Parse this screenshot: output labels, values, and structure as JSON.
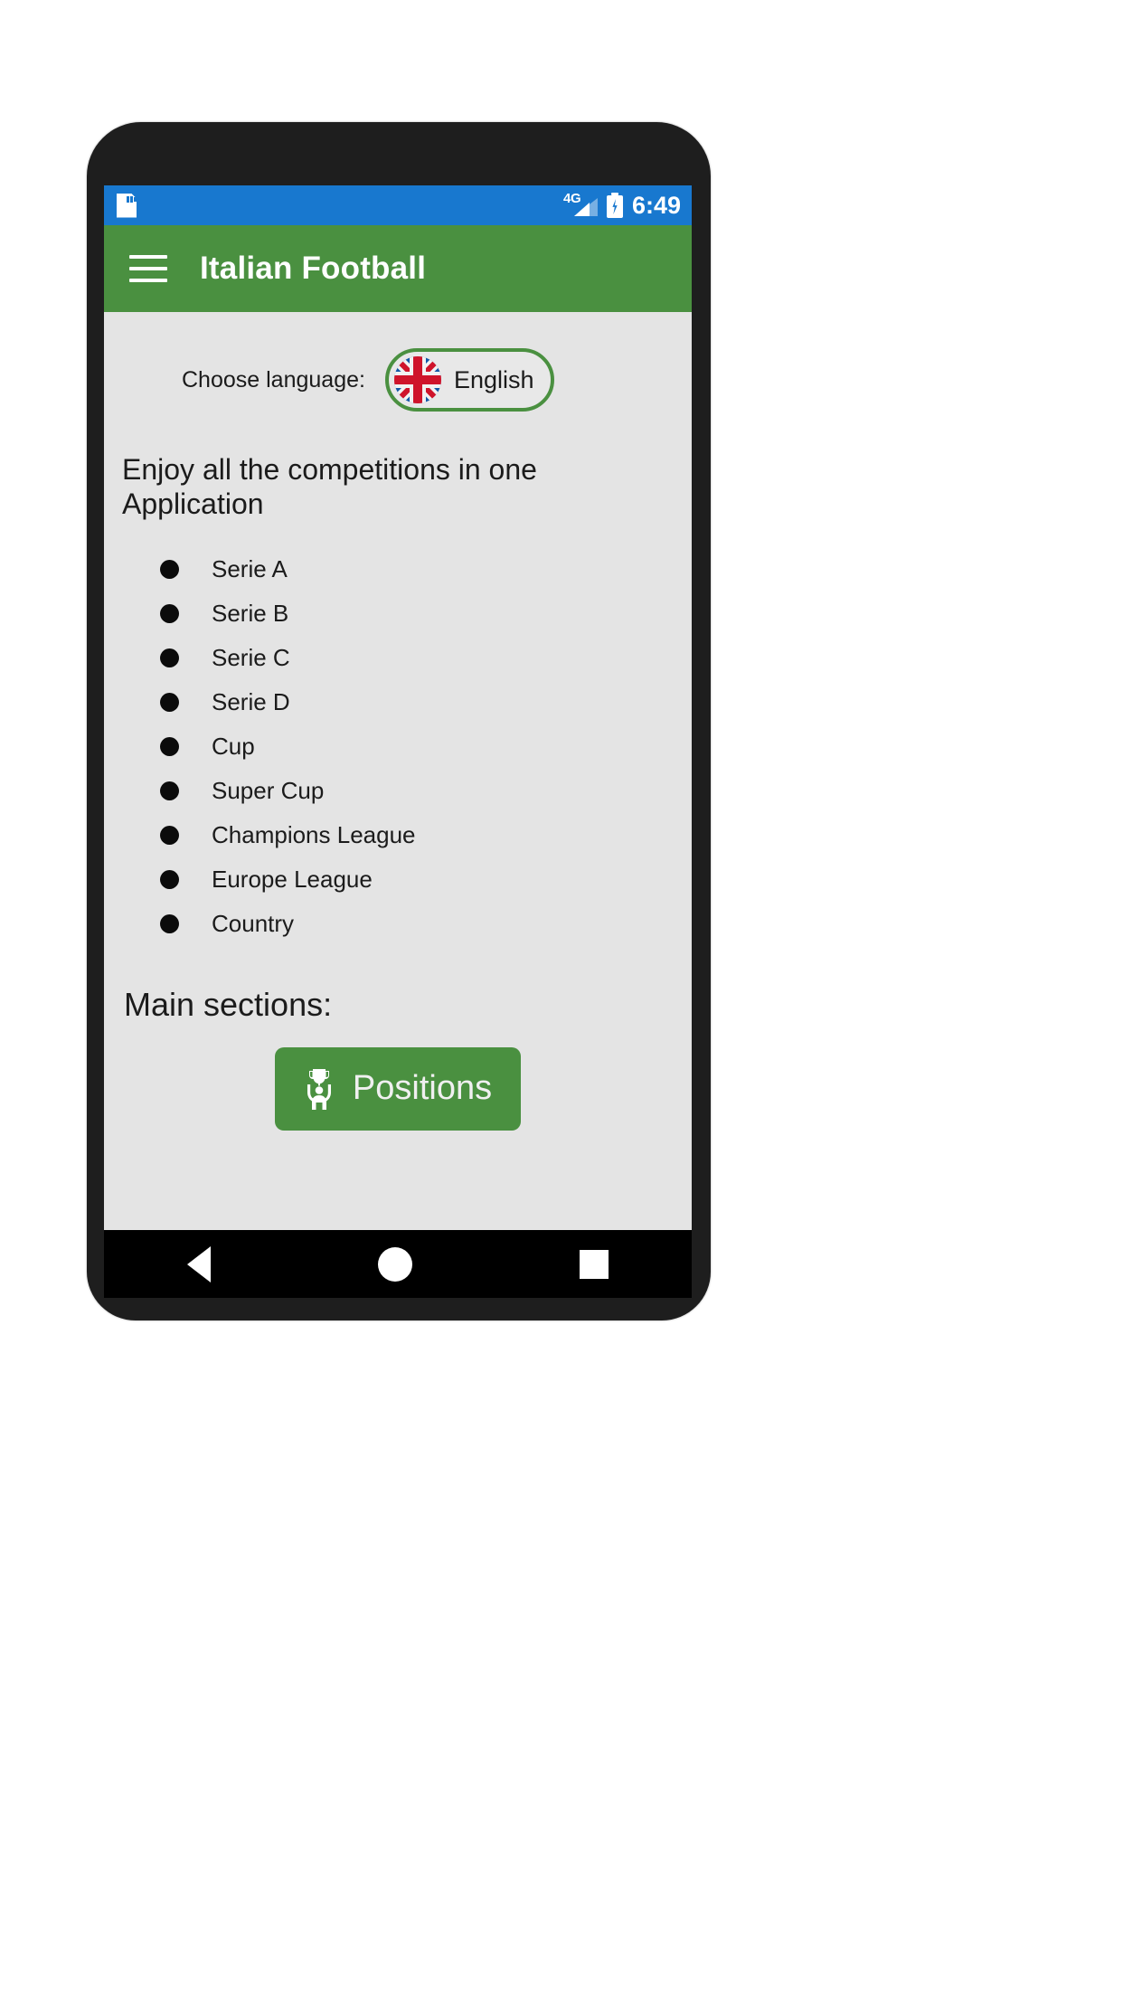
{
  "status_bar": {
    "sd_icon": "sd-card-icon",
    "network_type": "4G",
    "signal_icon": "signal-bars-icon",
    "battery_icon": "battery-charging-icon",
    "time": "6:49",
    "background_color": "#1878cf"
  },
  "app_bar": {
    "menu_icon": "hamburger-menu-icon",
    "title": "Italian Football",
    "background_color": "#4a9040"
  },
  "language": {
    "label": "Choose language:",
    "selected": "English",
    "flag_icon": "uk-flag-icon",
    "border_color": "#4a9040"
  },
  "intro": {
    "heading": "Enjoy all the competitions in one Application"
  },
  "competitions": [
    {
      "label": "Serie A"
    },
    {
      "label": "Serie B"
    },
    {
      "label": "Serie C"
    },
    {
      "label": "Serie D"
    },
    {
      "label": "Cup"
    },
    {
      "label": "Super Cup"
    },
    {
      "label": "Champions League"
    },
    {
      "label": "Europe League"
    },
    {
      "label": "Country"
    }
  ],
  "main_sections": {
    "title": "Main sections:",
    "buttons": [
      {
        "label": "Positions",
        "icon": "trophy-winner-icon",
        "color": "#4a9040"
      }
    ]
  },
  "nav_bar": {
    "back": "back-triangle-icon",
    "home": "home-circle-icon",
    "recents": "recents-square-icon"
  }
}
